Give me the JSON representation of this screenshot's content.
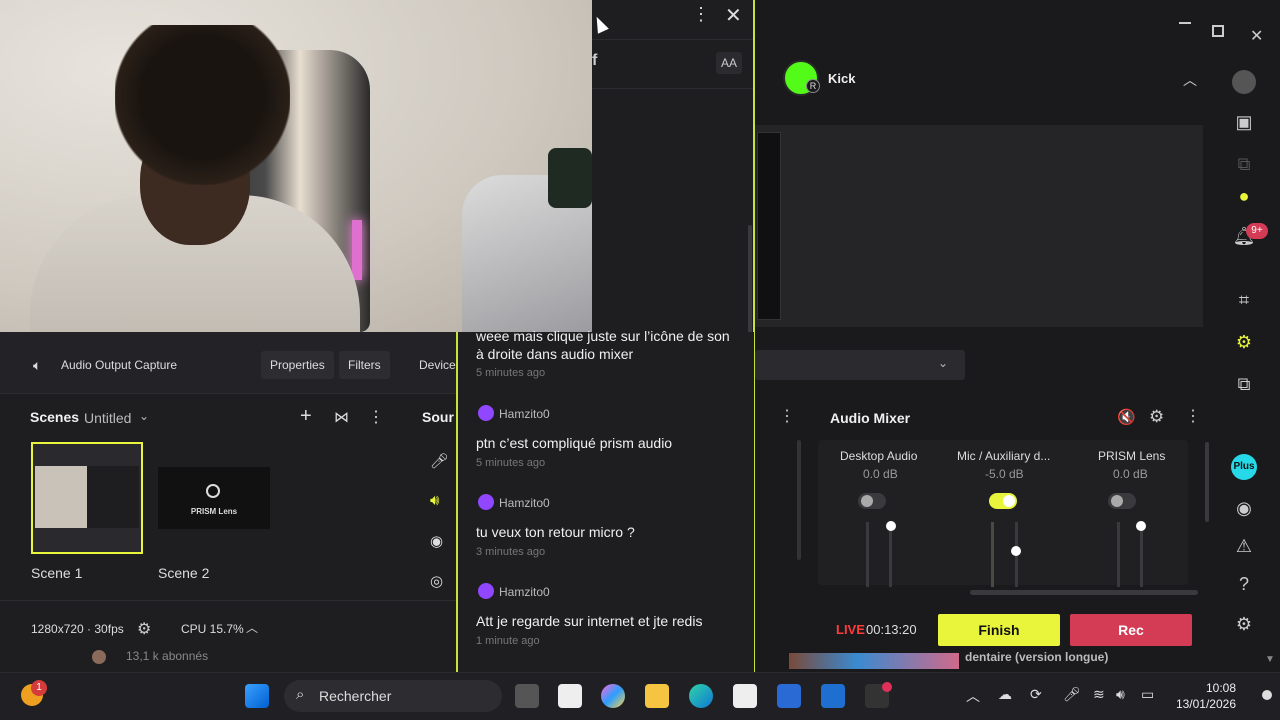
{
  "chat": {
    "font_size_label": "AA",
    "messages": [
      {
        "user": "",
        "text": "weee mais clique juste sur l’icône de son à droite dans audio mixer",
        "time": "5 minutes ago"
      },
      {
        "user": "Hamzito0",
        "text": "ptn c’est compliqué prism audio",
        "time": "5 minutes ago"
      },
      {
        "user": "Hamzito0",
        "text": "tu veux ton retour micro ?",
        "time": "3 minutes ago"
      },
      {
        "user": "Hamzito0",
        "text": "Att je regarde sur internet et jte redis",
        "time": "1 minute ago"
      }
    ]
  },
  "platform": {
    "name": "Kick",
    "badge": "R"
  },
  "source_bar": {
    "name": "Audio Output Capture",
    "properties": "Properties",
    "filters": "Filters",
    "device": "Device"
  },
  "scenes": {
    "title": "Scenes",
    "collection": "Untitled",
    "items": [
      {
        "label": "Scene 1"
      },
      {
        "label": "Scene 2"
      }
    ],
    "scene2_logo": "PRISM Lens"
  },
  "sources_title": "Sour",
  "status": {
    "resolution": "1280x720 · 30fps",
    "cpu": "CPU 15.7%",
    "live_label": "LIVE",
    "live_time": "00:13:20"
  },
  "buttons": {
    "finish": "Finish",
    "rec": "Rec"
  },
  "mixer": {
    "title": "Audio Mixer",
    "channels": [
      {
        "name": "Desktop Audio",
        "db": "0.0 dB",
        "level": 0.0
      },
      {
        "name": "Mic / Auxiliary d...",
        "db": "-5.0 dB",
        "level": 0.0
      },
      {
        "name": "PRISM Lens",
        "db": "0.0 dB",
        "level": 0.0
      }
    ]
  },
  "sidebar": {
    "notification_count": "9+",
    "plus_label": "Plus"
  },
  "background_text": {
    "subscribers": "13,1 k abonnés",
    "video_title": "dentaire (version longue)"
  },
  "taskbar": {
    "search_placeholder": "Rechercher",
    "time": "10:08",
    "date": "13/01/2026",
    "weather_badge": "1"
  },
  "colors": {
    "accent_lime": "#e8f53a",
    "rec_red": "#d43b55",
    "live_red": "#ff3b3b"
  }
}
